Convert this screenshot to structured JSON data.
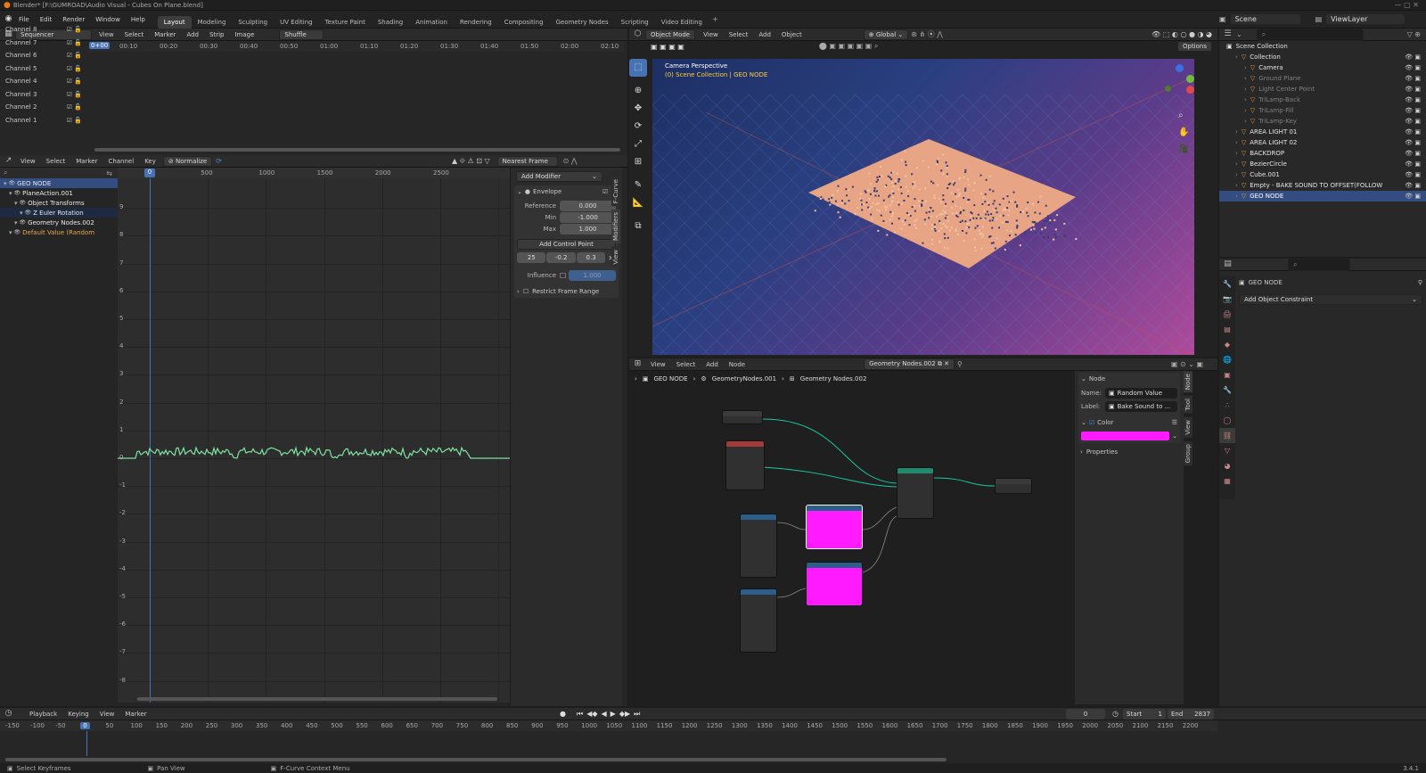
{
  "title": "Blender* [F:\\GUMROAD\\Audio Visual - Cubes On Plane.blend]",
  "menus": [
    "File",
    "Edit",
    "Render",
    "Window",
    "Help"
  ],
  "workspaces": [
    "Layout",
    "Modeling",
    "Sculpting",
    "UV Editing",
    "Texture Paint",
    "Shading",
    "Animation",
    "Rendering",
    "Compositing",
    "Geometry Nodes",
    "Scripting",
    "Video Editing"
  ],
  "active_workspace": "Layout",
  "scene": "Scene",
  "view_layer": "ViewLayer",
  "sequencer": {
    "editor": "Sequencer",
    "menus": [
      "View",
      "Select",
      "Marker",
      "Add",
      "Strip",
      "Image"
    ],
    "shuffle": "Shuffle",
    "current": "0+00",
    "times": [
      "00:10",
      "00:20",
      "00:30",
      "00:40",
      "00:50",
      "01:00",
      "01:10",
      "01:20",
      "01:30",
      "01:40",
      "01:50",
      "02:00",
      "02:10"
    ],
    "channels": [
      "Channel 8",
      "Channel 7",
      "Channel 6",
      "Channel 5",
      "Channel 4",
      "Channel 3",
      "Channel 2",
      "Channel 1"
    ]
  },
  "graph": {
    "menus": [
      "View",
      "Select",
      "Marker",
      "Channel",
      "Key"
    ],
    "normalize": "Normalize",
    "nearest_frame": "Nearest Frame",
    "frames": [
      "0",
      "500",
      "1000",
      "1500",
      "2000",
      "2500"
    ],
    "y_ticks": [
      "9",
      "8",
      "7",
      "6",
      "5",
      "4",
      "3",
      "2",
      "1",
      "0",
      "-1",
      "-2",
      "-3",
      "-4",
      "-5",
      "-6",
      "-7",
      "-8"
    ],
    "channels": [
      {
        "label": "GEO NODE",
        "color": "#e9e9e9",
        "indent": 0
      },
      {
        "label": "PlaneAction.001",
        "color": "#e9e9e9",
        "indent": 1
      },
      {
        "label": "Object Transforms",
        "color": "#e9e9e9",
        "indent": 2
      },
      {
        "label": "Z Euler Rotation",
        "color": "#e9e9e9",
        "indent": 3
      },
      {
        "label": "Geometry Nodes.002",
        "color": "#e9e9e9",
        "indent": 2
      },
      {
        "label": "Default Value (Random",
        "color": "#e8a94f",
        "indent": 1
      }
    ],
    "curve_color": "#7fe3a4",
    "side_tabs": [
      "F-Curve",
      "Modifiers",
      "View"
    ]
  },
  "modifier_panel": {
    "add_modifier": "Add Modifier",
    "name": "Envelope",
    "reference_label": "Reference",
    "reference": "0.000",
    "min_label": "Min",
    "min": "-1.000",
    "max_label": "Max",
    "max": "1.000",
    "add_control_point": "Add Control Point",
    "control_point": [
      "25",
      "-0.2",
      "0.3"
    ],
    "influence_label": "Influence",
    "influence": "1.000",
    "restrict": "Restrict Frame Range"
  },
  "viewport": {
    "mode": "Object Mode",
    "menus": [
      "View",
      "Select",
      "Add",
      "Object"
    ],
    "transform": "Global",
    "options": "Options",
    "camera_label": "Camera Perspective",
    "collection_label": "(0) Scene Collection | GEO NODE"
  },
  "node_editor": {
    "menus": [
      "View",
      "Select",
      "Add",
      "Node"
    ],
    "tree_name": "Geometry Nodes.002",
    "breadcrumbs": [
      "GEO NODE",
      "GeometryNodes.001",
      "Geometry Nodes.002"
    ],
    "node_panel_title": "Node",
    "name_label": "Name:",
    "name": "Random Value",
    "label_label": "Label:",
    "label": "Bake Sound to ...",
    "color_label": "Color",
    "node_color": "#ff1aff",
    "properties": "Properties",
    "tabs": [
      "Node",
      "Tool",
      "View",
      "Group"
    ]
  },
  "outliner": {
    "root": "Scene Collection",
    "items": [
      {
        "label": "Collection",
        "indent": 1,
        "color": "#e4e4e4"
      },
      {
        "label": "Camera",
        "indent": 2,
        "color": "#e4e4e4"
      },
      {
        "label": "Ground Plane",
        "indent": 2,
        "color": "#808080"
      },
      {
        "label": "Light Center Point",
        "indent": 2,
        "color": "#808080"
      },
      {
        "label": "TriLamp-Back",
        "indent": 2,
        "color": "#808080"
      },
      {
        "label": "TriLamp-Fill",
        "indent": 2,
        "color": "#808080"
      },
      {
        "label": "TriLamp-Key",
        "indent": 2,
        "color": "#808080"
      },
      {
        "label": "AREA LIGHT 01",
        "indent": 1,
        "color": "#e4e4e4"
      },
      {
        "label": "AREA LIGHT 02",
        "indent": 1,
        "color": "#e4e4e4"
      },
      {
        "label": "BACKDROP",
        "indent": 1,
        "color": "#e4e4e4"
      },
      {
        "label": "BezierCircle",
        "indent": 1,
        "color": "#e4e4e4"
      },
      {
        "label": "Cube.001",
        "indent": 1,
        "color": "#e4e4e4"
      },
      {
        "label": "Empty - BAKE SOUND TO OFFSET(FOLLOW PAT",
        "indent": 1,
        "color": "#e4e4e4"
      },
      {
        "label": "GEO NODE",
        "indent": 1,
        "color": "#ffffff"
      }
    ]
  },
  "properties": {
    "object": "GEO NODE",
    "add_constraint": "Add Object Constraint"
  },
  "timeline": {
    "menus": [
      "Playback",
      "Keying",
      "View",
      "Marker"
    ],
    "current_frame": "0",
    "start_label": "Start",
    "start": "1",
    "end_label": "End",
    "end": "2837",
    "ruler": [
      "-150",
      "-100",
      "-50",
      "0",
      "50",
      "100",
      "150",
      "200",
      "250",
      "300",
      "350",
      "400",
      "450",
      "500",
      "550",
      "600",
      "650",
      "700",
      "750",
      "800",
      "850",
      "900",
      "950",
      "1000",
      "1050",
      "1100",
      "1150",
      "1200",
      "1250",
      "1300",
      "1350",
      "1400",
      "1450",
      "1500",
      "1550",
      "1600",
      "1650",
      "1700",
      "1750",
      "1800",
      "1850",
      "1900",
      "1950",
      "2000",
      "2050",
      "2100",
      "2150",
      "2200"
    ]
  },
  "status": {
    "left": "Select Keyframes",
    "mid": "Pan View",
    "right": "F-Curve Context Menu",
    "version": "3.4.1"
  }
}
